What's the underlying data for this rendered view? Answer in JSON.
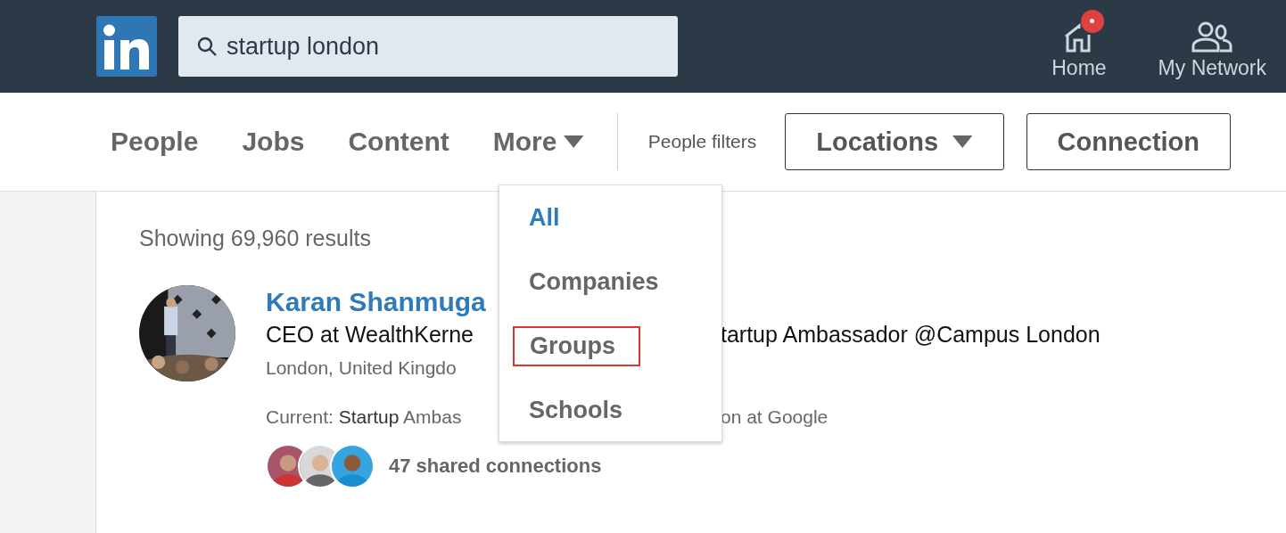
{
  "header": {
    "search": {
      "value": "startup london"
    },
    "nav": [
      {
        "label": "Home",
        "kind": "home",
        "notification": true
      },
      {
        "label": "My Network",
        "kind": "network",
        "notification": false
      }
    ]
  },
  "tabs": [
    {
      "label": "People",
      "caret": false
    },
    {
      "label": "Jobs",
      "caret": false
    },
    {
      "label": "Content",
      "caret": false
    },
    {
      "label": "More",
      "caret": true
    }
  ],
  "filters": {
    "label": "People filters",
    "buttons": [
      {
        "label": "Locations",
        "caret": true
      },
      {
        "label": "Connection",
        "caret": false
      }
    ]
  },
  "dropdown": [
    {
      "label": "All",
      "selected": true,
      "outlined": false
    },
    {
      "label": "Companies",
      "selected": false,
      "outlined": false
    },
    {
      "label": "Groups",
      "selected": false,
      "outlined": true
    },
    {
      "label": "Schools",
      "selected": false,
      "outlined": false
    }
  ],
  "results": {
    "summary": "Showing 69,960 results",
    "items": [
      {
        "name": "Karan Shanmuga",
        "headline": [
          "CEO at WealthKerne",
          "tartup Ambassador @Campus London"
        ],
        "location": "London, United Kingdo",
        "current": [
          "Current: **Startup** Ambas",
          "on at Google"
        ],
        "shared": "47 shared connections"
      }
    ]
  }
}
